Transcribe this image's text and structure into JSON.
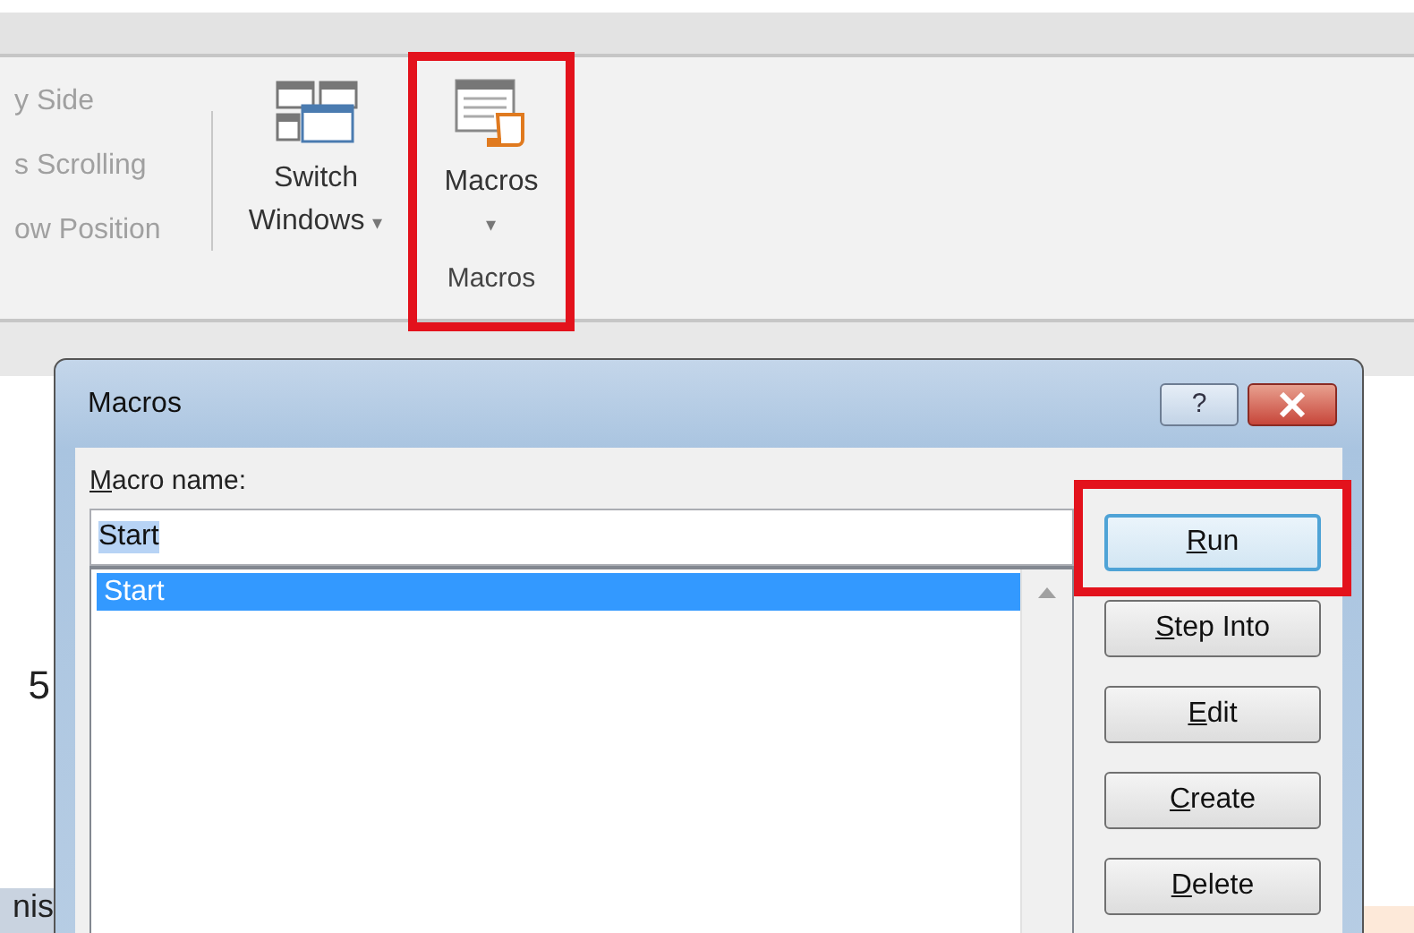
{
  "ribbon": {
    "window_group": [
      {
        "label": "y Side",
        "disabled": true
      },
      {
        "label": "s Scrolling",
        "disabled": true
      },
      {
        "label": "ow Position",
        "disabled": true
      }
    ],
    "switch_windows": {
      "label_lines": [
        "Switch",
        "Windows"
      ],
      "caret": "▾"
    },
    "macros_button": {
      "label": "Macros",
      "caret": "▾",
      "highlighted": true
    },
    "group_label": "Macros"
  },
  "sheet": {
    "cells": [
      "5",
      "nis"
    ]
  },
  "dialog": {
    "title": "Macros",
    "help": "?",
    "name_label": {
      "underlined": "M",
      "rest": "acro name:"
    },
    "name_field": {
      "value": "Start",
      "text_selected": true
    },
    "macro_list": [
      {
        "label": "Start",
        "selected": true
      }
    ],
    "buttons": [
      {
        "underlined": "R",
        "rest": "un",
        "highlighted": true,
        "focused": true
      },
      {
        "underlined": "S",
        "rest": "tep Into",
        "highlighted": false,
        "focused": false
      },
      {
        "underlined": "E",
        "rest": "dit",
        "highlighted": false,
        "focused": false
      },
      {
        "underlined": "C",
        "rest": "reate",
        "highlighted": false,
        "focused": false
      },
      {
        "underlined": "D",
        "rest": "elete",
        "highlighted": false,
        "focused": false
      }
    ]
  }
}
